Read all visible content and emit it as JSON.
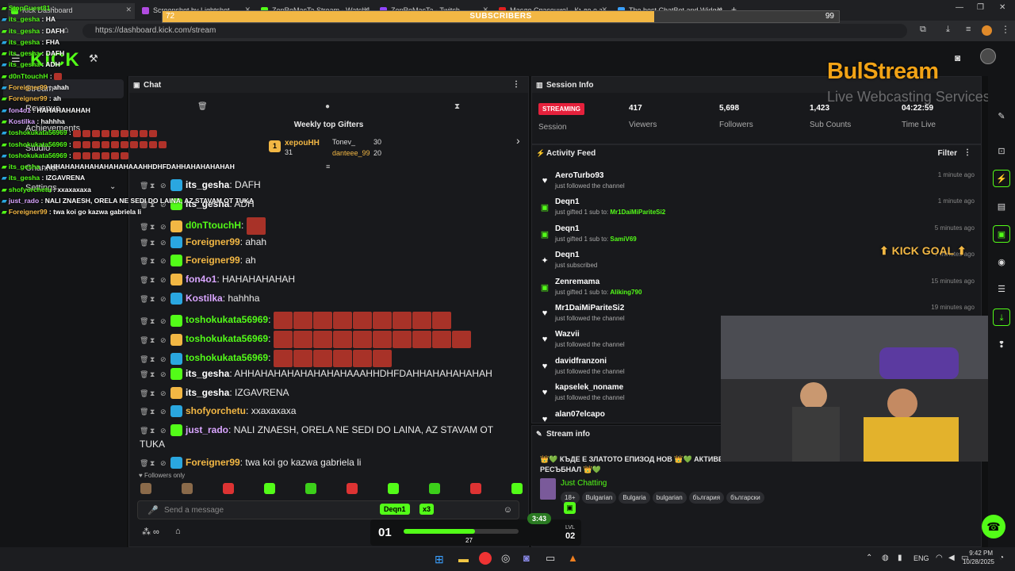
{
  "browser": {
    "tabs": [
      {
        "label": "Kick Dashboard",
        "color": "#53fc18"
      },
      {
        "label": "Screenshot by Lightshot",
        "color": "#b04be0"
      },
      {
        "label": "ZenRoMacTa Stream - Watch L",
        "color": "#53fc18"
      },
      {
        "label": "ZenRoMacTa - Twitch",
        "color": "#9146ff"
      },
      {
        "label": "Масло Спасение! - Къде е з",
        "color": "#e02020"
      },
      {
        "label": "The best ChatBot and Widget",
        "color": "#3aa0ff"
      }
    ],
    "url": "https://dashboard.kick.com/stream"
  },
  "subscribers_bar": {
    "label": "SUBSCRIBERS",
    "current": "72",
    "goal": "99",
    "progress": 0.727
  },
  "logo": "KICK",
  "overlay_chat": [
    {
      "user": "StopGuest81",
      "msg": ""
    },
    {
      "user": "its_gesha",
      "msg": "HA"
    },
    {
      "user": "its_gesha",
      "msg": "DAFH"
    },
    {
      "user": "its_gesha",
      "msg": "FHA"
    },
    {
      "user": "its_gesha",
      "msg": "DAFH"
    },
    {
      "user": "its_gesha",
      "msg": "ADH"
    },
    {
      "user": "d0nTtouchH",
      "msg": ""
    },
    {
      "user": "Foreigner99",
      "msg": "ahah"
    },
    {
      "user": "Foreigner99",
      "msg": "ah"
    },
    {
      "user": "fon4o1",
      "msg": "HAHAHAHAHAH"
    },
    {
      "user": "Kostilka",
      "msg": "hahhha"
    },
    {
      "user": "toshokukata56969",
      "msg": ""
    },
    {
      "user": "toshokukata56969",
      "msg": ""
    },
    {
      "user": "toshokukata56969",
      "msg": ""
    },
    {
      "user": "its_gesha",
      "msg": "AHHAHAHAHAHAHAHAHAAAHHDHFDAHHAHAHAHAHAH"
    },
    {
      "user": "its_gesha",
      "msg": "IZGAVRENA"
    },
    {
      "user": "shofyorchetu",
      "msg": "xxaxaxaxa"
    },
    {
      "user": "just_rado",
      "msg": "NALI ZNAESH, ORELA NE SEDI DO LAINA, AZ STAVAM OT TUKA"
    },
    {
      "user": "Foreigner99",
      "msg": "twa koi go kazwa gabriela li"
    }
  ],
  "sidebar": {
    "items": [
      "Stream",
      "Revenue",
      "Achievements",
      "Studio",
      "Channel",
      "Settings"
    ]
  },
  "chat": {
    "title": "Chat",
    "gifters_title": "Weekly top Gifters",
    "gifters": [
      {
        "rank": "1",
        "name": "xepouHH",
        "count": "31"
      },
      {
        "name": "Tonev_",
        "count": "30"
      },
      {
        "name": "danteee_99",
        "count": "20"
      }
    ],
    "messages": [
      {
        "user": "its_gesha",
        "color": "#ffffff",
        "msg": "DAFH"
      },
      {
        "user": "its_gesha",
        "color": "#ffffff",
        "msg": "ADH"
      },
      {
        "user": "d0nTtouchH",
        "color": "#53fc18",
        "msg": ""
      },
      {
        "user": "Foreigner99",
        "color": "#f2b744",
        "msg": "ahah"
      },
      {
        "user": "Foreigner99",
        "color": "#f2b744",
        "msg": "ah"
      },
      {
        "user": "fon4o1",
        "color": "#d9a5ff",
        "msg": "HAHAHAHAHAH"
      },
      {
        "user": "Kostilka",
        "color": "#d9a5ff",
        "msg": "hahhha"
      },
      {
        "user": "toshokukata56969",
        "color": "#53fc18",
        "msg": ""
      },
      {
        "user": "toshokukata56969",
        "color": "#53fc18",
        "msg": ""
      },
      {
        "user": "toshokukata56969",
        "color": "#53fc18",
        "msg": ""
      },
      {
        "user": "its_gesha",
        "color": "#ffffff",
        "msg": "AHHAHAHAHAHAHAHAHAAAHHDHFDAHHAHAHAHAHAH"
      },
      {
        "user": "its_gesha",
        "color": "#ffffff",
        "msg": "IZGAVRENA"
      },
      {
        "user": "shofyorchetu",
        "color": "#f2b744",
        "msg": "xxaxaxaxa"
      },
      {
        "user": "just_rado",
        "color": "#d9a5ff",
        "msg": "NALI ZNAESH, ORELA NE SEDI DO LAINA, AZ STAVAM OT"
      },
      {
        "user": "",
        "color": "#ffffff",
        "msg": "TUKA"
      },
      {
        "user": "Foreigner99",
        "color": "#f2b744",
        "msg": "twa koi go kazwa gabriela li"
      }
    ],
    "followers_only": "Followers only",
    "input_placeholder": "Send a message",
    "pill_user": "Deqn1",
    "pill_mult": "x3"
  },
  "session": {
    "title": "Session Info",
    "status_badge": "STREAMING",
    "status_label": "Session",
    "stats": [
      {
        "value": "417",
        "label": "Viewers"
      },
      {
        "value": "5,698",
        "label": "Followers"
      },
      {
        "value": "1,423",
        "label": "Sub Counts"
      },
      {
        "value": "04:22:59",
        "label": "Time Live"
      }
    ]
  },
  "overlay_brand": {
    "name": "BulStream",
    "tagline": "Live Webcasting Services"
  },
  "feed": {
    "title": "Activity Feed",
    "filter": "Filter",
    "items": [
      {
        "icon": "heart-icon",
        "glyph": "♥",
        "user": "AeroTurbo93",
        "desc": "just followed the channel",
        "extra": "",
        "time": "1 minute ago"
      },
      {
        "icon": "gift-icon",
        "glyph": "▣",
        "user": "Deqn1",
        "desc": "just gifted 1 sub to: ",
        "extra": "Mr1DaiMiPariteSi2",
        "time": "1 minute ago"
      },
      {
        "icon": "gift-icon",
        "glyph": "▣",
        "user": "Deqn1",
        "desc": "just gifted 1 sub to: ",
        "extra": "SamiV69",
        "time": "5 minutes ago"
      },
      {
        "icon": "star-icon",
        "glyph": "✦",
        "user": "Deqn1",
        "desc": "just subscribed",
        "extra": "",
        "time": "7 minutes ago"
      },
      {
        "icon": "gift-icon",
        "glyph": "▣",
        "user": "Zenremama",
        "desc": "just gifted 1 sub to: ",
        "extra": "Aliking790",
        "time": "15 minutes ago"
      },
      {
        "icon": "heart-icon",
        "glyph": "♥",
        "user": "Mr1DaiMiPariteSi2",
        "desc": "just followed the channel",
        "extra": "",
        "time": "19 minutes ago"
      },
      {
        "icon": "heart-icon",
        "glyph": "♥",
        "user": "Wazvii",
        "desc": "just followed the channel",
        "extra": "",
        "time": ""
      },
      {
        "icon": "heart-icon",
        "glyph": "♥",
        "user": "davidfranzoni",
        "desc": "just followed the channel",
        "extra": "",
        "time": ""
      },
      {
        "icon": "heart-icon",
        "glyph": "♥",
        "user": "kapselek_noname",
        "desc": "just followed the channel",
        "extra": "",
        "time": ""
      },
      {
        "icon": "heart-icon",
        "glyph": "♥",
        "user": "alan07elcapo",
        "desc": "",
        "extra": "",
        "time": ""
      }
    ]
  },
  "kick_goal": "KICK GOAL",
  "stream_info": {
    "title": "Stream info",
    "stream_title_1": "👑💚 КЪДЕ Е ЗЛАТОТО ЕПИЗОД НОВ 👑💚 АКТИВЕ",
    "stream_title_2": "РЕСЪБНАЛ 👑💚",
    "category": "Just Chatting",
    "tags": [
      "18+",
      "Bulgarian",
      "Bulgaria",
      "bulgarian",
      "българия",
      "български"
    ]
  },
  "level_bar": {
    "level_left": "01",
    "xp": "27",
    "timer": "3:43",
    "lvl_label": "LVL",
    "level_right": "02",
    "progress": 0.62
  },
  "taskbar": {
    "lang": "ENG",
    "time": "9:42 PM",
    "date": "10/28/2025"
  },
  "colors": {
    "kick_green": "#53fc18",
    "streaming_red": "#e5213c",
    "gold": "#f2b744"
  }
}
